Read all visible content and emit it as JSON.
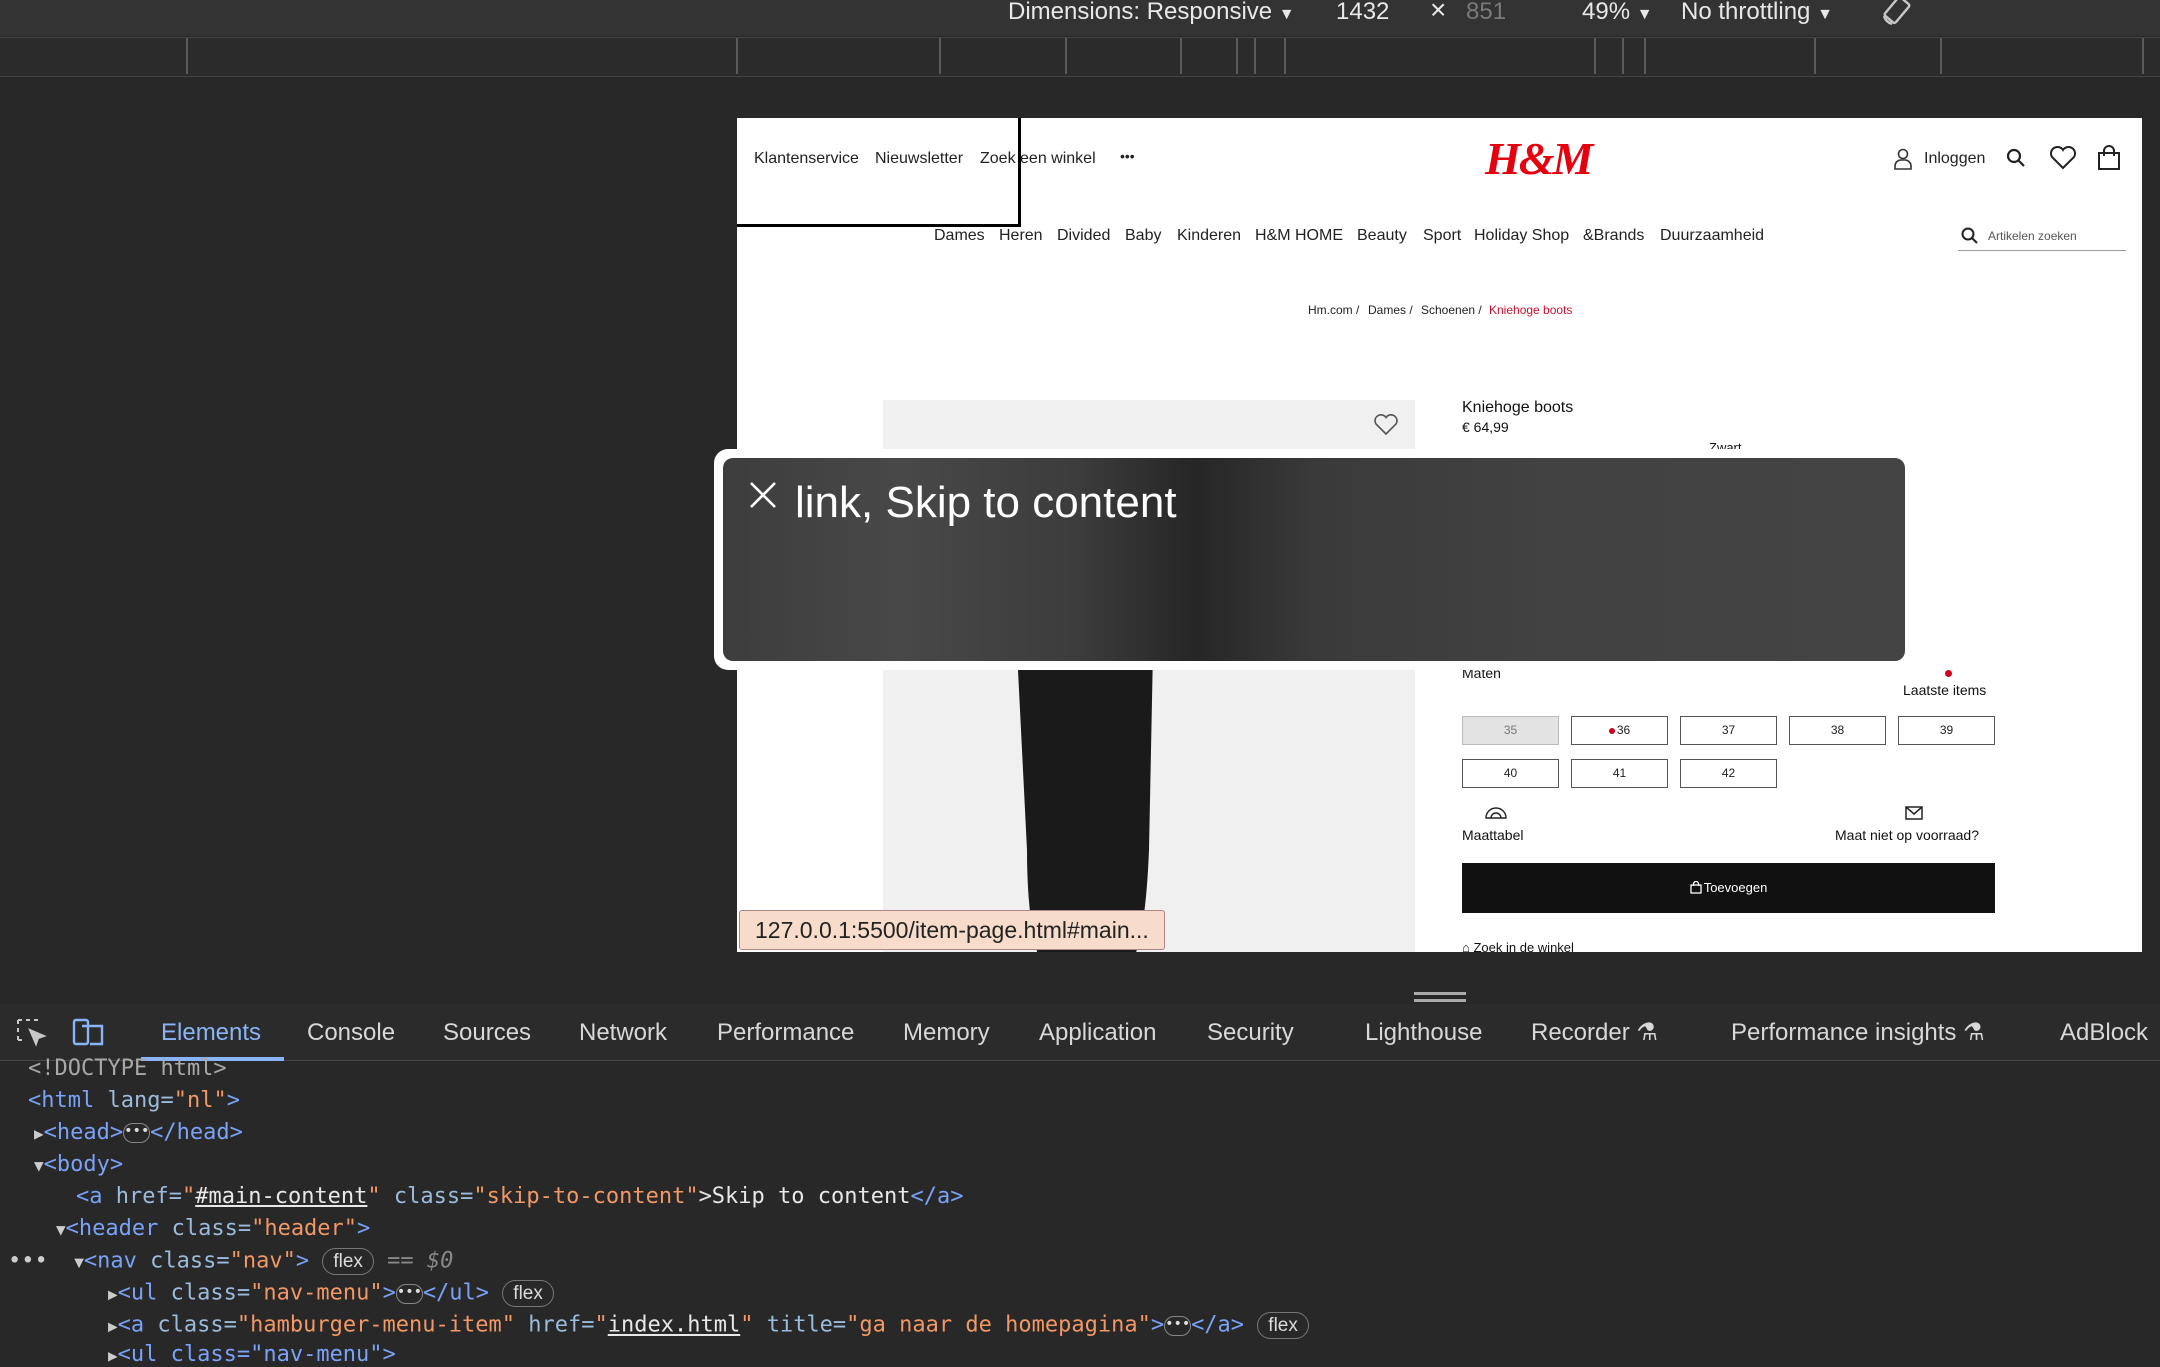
{
  "device_toolbar": {
    "dimensions": "Dimensions: Responsive",
    "width": "1432",
    "times": "×",
    "height": "851",
    "zoom": "49%",
    "throttling": "No throttling"
  },
  "site": {
    "top_links": [
      "Klantenservice",
      "Nieuwsletter",
      "Zoek een winkel"
    ],
    "more": "•••",
    "logo": "H&M",
    "login": "Inloggen",
    "categories": [
      "Dames",
      "Heren",
      "Divided",
      "Baby",
      "Kinderen",
      "H&M HOME",
      "Beauty",
      "Sport",
      "Holiday Shop",
      "&Brands",
      "Duurzaamheid"
    ],
    "search_placeholder": "Artikelen zoeken",
    "breadcrumb": [
      "Hm.com /",
      "Dames /",
      "Schoenen /",
      "Kniehoge boots"
    ],
    "product": {
      "title": "Kniehoge boots",
      "price": "€ 64,99",
      "color": "Zwart",
      "sizes_label": "Maten",
      "last_items": "Laatste items",
      "sizes": [
        "35",
        "36",
        "37",
        "38",
        "39",
        "40",
        "41",
        "42"
      ],
      "size_chart": "Maattabel",
      "size_unavailable": "Maat niet op voorraad?",
      "add_button": "Toevoegen",
      "find_in_store": "Zoek in de winkel"
    },
    "status_url": "127.0.0.1:5500/item-page.html#main..."
  },
  "a11y_popup": {
    "text": "link, Skip to content"
  },
  "devtools": {
    "tabs": [
      "Elements",
      "Console",
      "Sources",
      "Network",
      "Performance",
      "Memory",
      "Application",
      "Security",
      "Lighthouse",
      "Recorder",
      "Performance insights",
      "AdBlock"
    ],
    "active_tab": "Elements",
    "dom": {
      "doctype": "<!DOCTYPE html>",
      "html_open": "<html",
      "html_attr": " lang=",
      "html_val": "\"nl\"",
      "html_close": ">",
      "head": "<head>",
      "head_close": "</head>",
      "body": "<body>",
      "a_open": "<a",
      "a_href_attr": " href=",
      "a_href_q1": "\"",
      "a_href_val": "#main-content",
      "a_href_q2": "\"",
      "a_class_attr": " class=",
      "a_class_val": "\"skip-to-content\"",
      "a_text": ">Skip to content",
      "a_close": "</a>",
      "header_open": "<header",
      "header_class_attr": " class=",
      "header_class_val": "\"header\"",
      "header_gt": ">",
      "nav_open": "<nav",
      "nav_class_attr": " class=",
      "nav_class_val": "\"nav\"",
      "nav_gt": ">",
      "flex": "flex",
      "selected_marker": "== $0",
      "ul_open": "<ul",
      "ul_class_attr": " class=",
      "ul_class_val": "\"nav-menu\"",
      "ul_gt": ">",
      "ul_close": "</ul>",
      "a2_open": "<a",
      "a2_class_attr": " class=",
      "a2_class_val": "\"hamburger-menu-item\"",
      "a2_href_attr": " href=",
      "a2_href_q1": "\"",
      "a2_href_val": "index.html",
      "a2_href_q2": "\"",
      "a2_title_attr": " title=",
      "a2_title_val": "\"ga naar de homepagina\"",
      "a2_gt": ">",
      "a2_close": "</a>",
      "ul2_partial": "<ul class=\"nav-menu\">",
      "ellipsis": "•••"
    }
  }
}
